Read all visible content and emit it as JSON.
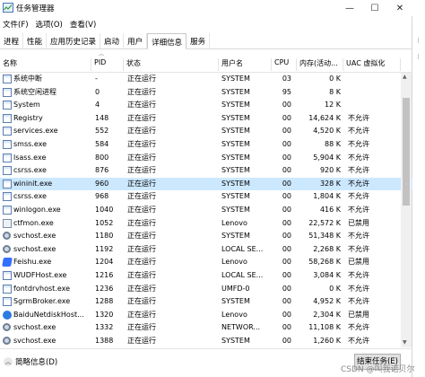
{
  "window": {
    "title": "任务管理器",
    "controls": {
      "minimize": "—",
      "maximize": "☐",
      "close": "✕"
    }
  },
  "menu": [
    "文件(F)",
    "选项(O)",
    "查看(V)"
  ],
  "tabs": [
    "进程",
    "性能",
    "应用历史记录",
    "启动",
    "用户",
    "详细信息",
    "服务"
  ],
  "active_tab": "详细信息",
  "columns": [
    "名称",
    "PID",
    "状态",
    "用户名",
    "CPU",
    "内存(活动...",
    "UAC 虚拟化"
  ],
  "rows": [
    {
      "icon": "app-window-icon",
      "name": "系统中断",
      "pid": "-",
      "status": "正在运行",
      "user": "SYSTEM",
      "cpu": "03",
      "mem": "0 K",
      "uac": ""
    },
    {
      "icon": "app-window-icon",
      "name": "系统空闲进程",
      "pid": "0",
      "status": "正在运行",
      "user": "SYSTEM",
      "cpu": "95",
      "mem": "8 K",
      "uac": ""
    },
    {
      "icon": "app-window-icon",
      "name": "System",
      "pid": "4",
      "status": "正在运行",
      "user": "SYSTEM",
      "cpu": "00",
      "mem": "12 K",
      "uac": ""
    },
    {
      "icon": "app-window-icon",
      "name": "Registry",
      "pid": "148",
      "status": "正在运行",
      "user": "SYSTEM",
      "cpu": "00",
      "mem": "14,624 K",
      "uac": "不允许"
    },
    {
      "icon": "app-window-icon",
      "name": "services.exe",
      "pid": "552",
      "status": "正在运行",
      "user": "SYSTEM",
      "cpu": "00",
      "mem": "4,520 K",
      "uac": "不允许"
    },
    {
      "icon": "app-window-icon",
      "name": "smss.exe",
      "pid": "584",
      "status": "正在运行",
      "user": "SYSTEM",
      "cpu": "00",
      "mem": "88 K",
      "uac": "不允许"
    },
    {
      "icon": "app-window-icon",
      "name": "lsass.exe",
      "pid": "800",
      "status": "正在运行",
      "user": "SYSTEM",
      "cpu": "00",
      "mem": "5,904 K",
      "uac": "不允许"
    },
    {
      "icon": "app-window-icon",
      "name": "csrss.exe",
      "pid": "876",
      "status": "正在运行",
      "user": "SYSTEM",
      "cpu": "00",
      "mem": "920 K",
      "uac": "不允许"
    },
    {
      "icon": "app-window-icon",
      "name": "wininit.exe",
      "pid": "960",
      "status": "正在运行",
      "user": "SYSTEM",
      "cpu": "00",
      "mem": "328 K",
      "uac": "不允许",
      "selected": true
    },
    {
      "icon": "app-window-icon",
      "name": "csrss.exe",
      "pid": "968",
      "status": "正在运行",
      "user": "SYSTEM",
      "cpu": "00",
      "mem": "1,804 K",
      "uac": "不允许"
    },
    {
      "icon": "app-window-icon",
      "name": "winlogon.exe",
      "pid": "1040",
      "status": "正在运行",
      "user": "SYSTEM",
      "cpu": "00",
      "mem": "416 K",
      "uac": "不允许"
    },
    {
      "icon": "ctfmon-icon",
      "name": "ctfmon.exe",
      "pid": "1052",
      "status": "正在运行",
      "user": "Lenovo",
      "cpu": "00",
      "mem": "22,572 K",
      "uac": "已禁用"
    },
    {
      "icon": "gear-icon",
      "name": "svchost.exe",
      "pid": "1180",
      "status": "正在运行",
      "user": "SYSTEM",
      "cpu": "00",
      "mem": "51,348 K",
      "uac": "不允许"
    },
    {
      "icon": "gear-icon",
      "name": "svchost.exe",
      "pid": "1192",
      "status": "正在运行",
      "user": "LOCAL SE...",
      "cpu": "00",
      "mem": "2,268 K",
      "uac": "不允许"
    },
    {
      "icon": "feishu-icon",
      "name": "Feishu.exe",
      "pid": "1204",
      "status": "正在运行",
      "user": "Lenovo",
      "cpu": "00",
      "mem": "58,268 K",
      "uac": "已禁用"
    },
    {
      "icon": "app-window-icon",
      "name": "WUDFHost.exe",
      "pid": "1216",
      "status": "正在运行",
      "user": "LOCAL SE...",
      "cpu": "00",
      "mem": "3,084 K",
      "uac": "不允许"
    },
    {
      "icon": "app-window-icon",
      "name": "fontdrvhost.exe",
      "pid": "1236",
      "status": "正在运行",
      "user": "UMFD-0",
      "cpu": "00",
      "mem": "0 K",
      "uac": "不允许"
    },
    {
      "icon": "app-window-icon",
      "name": "SgrmBroker.exe",
      "pid": "1288",
      "status": "正在运行",
      "user": "SYSTEM",
      "cpu": "00",
      "mem": "4,952 K",
      "uac": "不允许"
    },
    {
      "icon": "baidu-icon",
      "name": "BaiduNetdiskHost...",
      "pid": "1320",
      "status": "正在运行",
      "user": "Lenovo",
      "cpu": "00",
      "mem": "2,304 K",
      "uac": "已禁用"
    },
    {
      "icon": "gear-icon",
      "name": "svchost.exe",
      "pid": "1332",
      "status": "正在运行",
      "user": "NETWOR...",
      "cpu": "00",
      "mem": "11,108 K",
      "uac": "不允许"
    },
    {
      "icon": "gear-icon",
      "name": "svchost.exe",
      "pid": "1388",
      "status": "正在运行",
      "user": "SYSTEM",
      "cpu": "00",
      "mem": "1,260 K",
      "uac": "不允许"
    }
  ],
  "footer": {
    "brief_label": "简略信息(D)",
    "end_task_label": "结束任务(E)"
  },
  "watermark": "CSDN @叫我诺贝尔"
}
